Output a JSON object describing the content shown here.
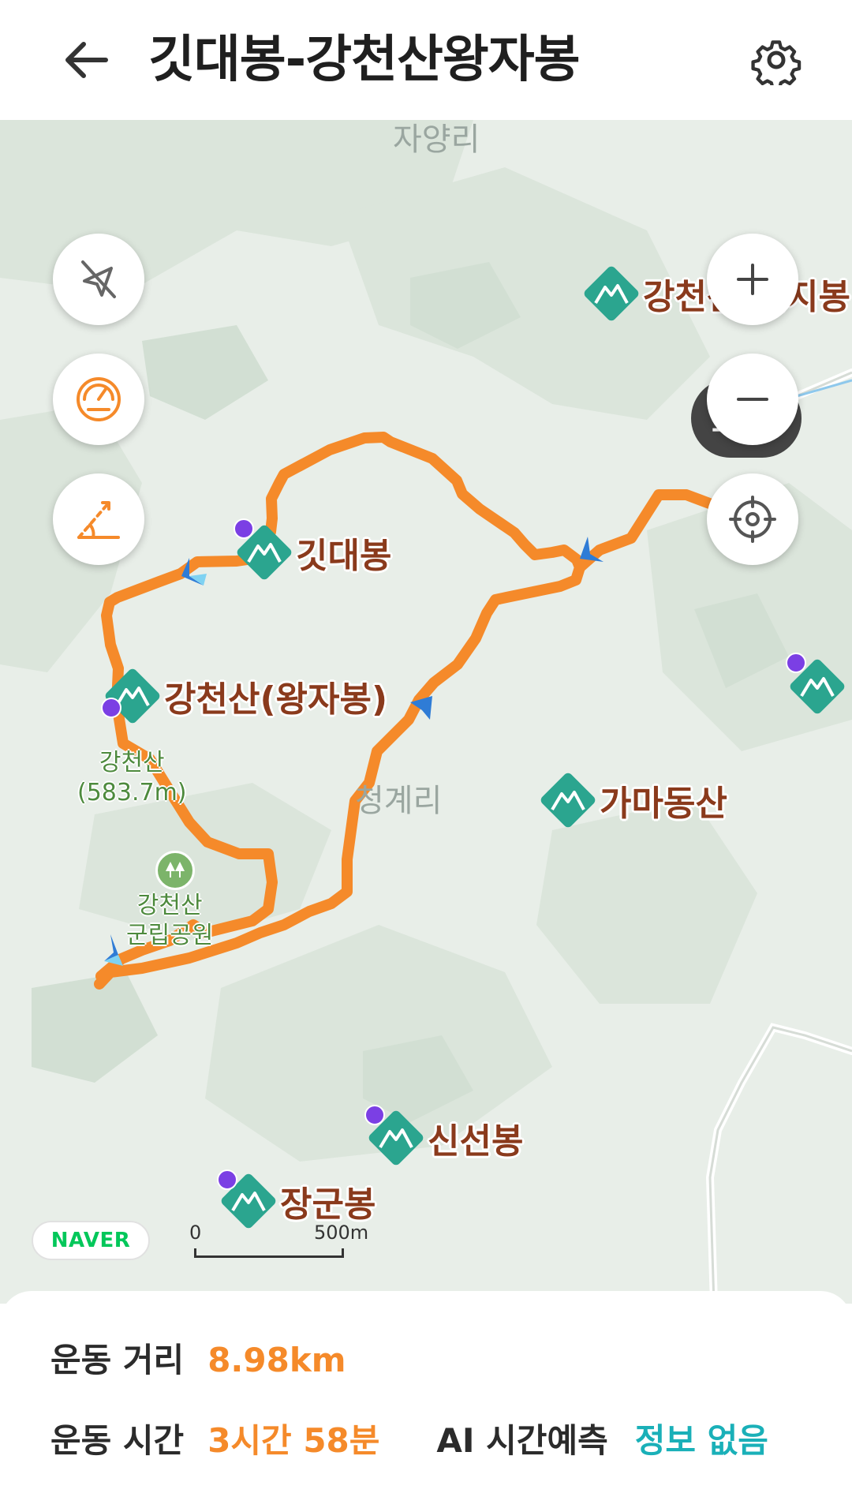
{
  "header": {
    "title": "깃대봉-강천산왕자봉"
  },
  "map": {
    "places": {
      "village_top": "자양리",
      "village_center": "청계리"
    },
    "pois": [
      {
        "id": "gangcheonsan-cheonjibong",
        "label": "강천산(천지봉"
      },
      {
        "id": "gitdaebong",
        "label": "깃대봉"
      },
      {
        "id": "gangcheonsan-wangjabong",
        "label": "강천산(왕자봉)"
      },
      {
        "id": "gamadongsan",
        "label": "가마동산"
      },
      {
        "id": "sinseonbong",
        "label": "신선봉"
      },
      {
        "id": "janggunbong",
        "label": "장군봉"
      }
    ],
    "summit_label": {
      "name": "강천산",
      "elevation": "(583.7m)"
    },
    "park_label": {
      "line1": "강천산",
      "line2": "군립공원"
    },
    "arrival_label": "도착",
    "naver_logo": "NAVER",
    "scale": {
      "zero": "0",
      "max": "500m"
    },
    "route_color": "#F58A2A",
    "poi_color": "#2BA58F"
  },
  "stats": {
    "distance_label": "운동 거리",
    "distance_value": "8.98km",
    "time_label": "운동 시간",
    "time_value": "3시간 58분",
    "ai_label": "AI 시간예측",
    "ai_value": "정보 없음"
  },
  "colors": {
    "accent_orange": "#F58A2A",
    "accent_teal": "#1AB0B8"
  }
}
